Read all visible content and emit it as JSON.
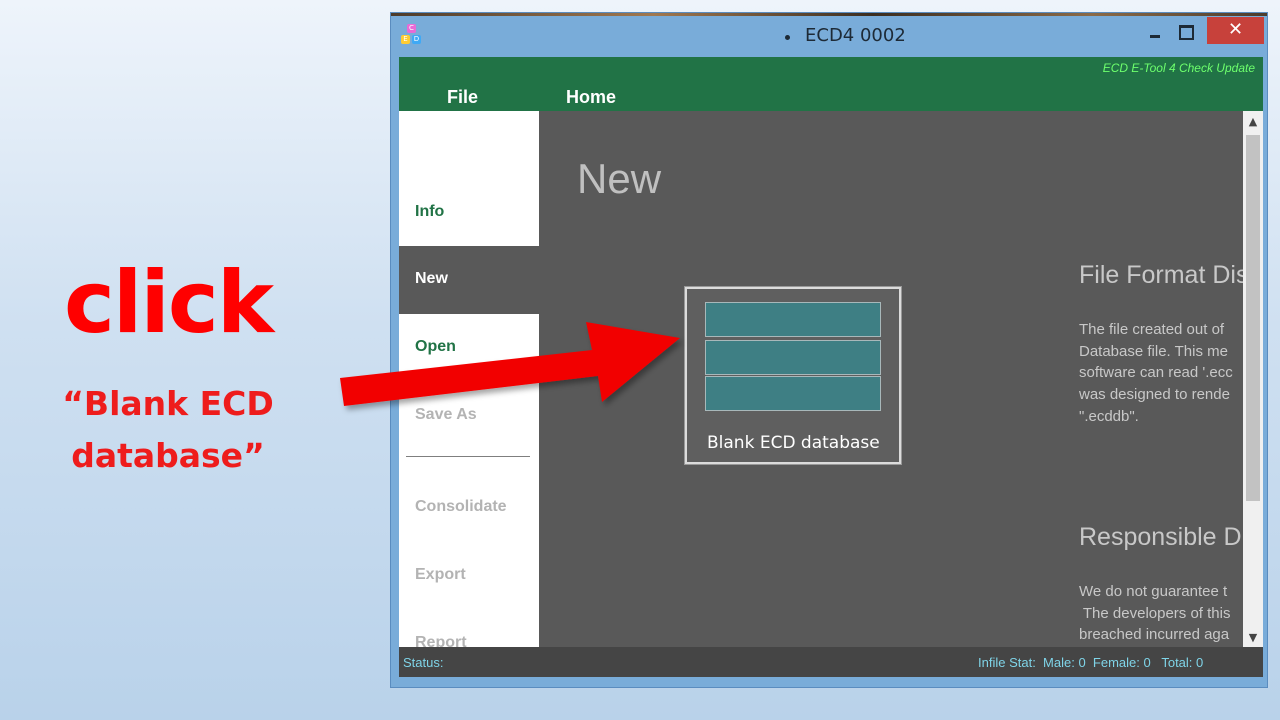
{
  "annotation": {
    "headline": "click",
    "caption_line1": "“Blank ECD",
    "caption_line2": "database”"
  },
  "window": {
    "title": "ECD4 0002",
    "close_glyph": "✕"
  },
  "ribbon": {
    "check_update": "ECD E-Tool 4 Check Update",
    "file_menu": "File",
    "home_menu": "Home"
  },
  "sidebar": {
    "items": [
      {
        "label": "Info",
        "state": "enabled"
      },
      {
        "label": "New",
        "state": "selected"
      },
      {
        "label": "Open",
        "state": "enabled"
      },
      {
        "label": "Save As",
        "state": "disabled"
      },
      {
        "label": "Consolidate",
        "state": "disabled"
      },
      {
        "label": "Export",
        "state": "disabled"
      },
      {
        "label": "Report",
        "state": "disabled"
      }
    ]
  },
  "main": {
    "page_title": "New",
    "template_label": "Blank ECD database",
    "file_format": {
      "heading": "File Format Dis",
      "lines": [
        "The file created out of",
        "Database file. This me",
        "software can read '.ecc",
        "was designed to rende",
        "\".ecddb\"."
      ]
    },
    "responsible": {
      "heading": "Responsible D",
      "lines": [
        "We do not guarantee t",
        " The developers of this",
        "breached incurred aga"
      ]
    }
  },
  "scrollbar": {
    "up_glyph": "▲",
    "down_glyph": "▼"
  },
  "status": {
    "label": "Status:",
    "infile_stat": "Infile Stat:",
    "male": "Male: 0",
    "female": "Female: 0",
    "total": "Total: 0"
  },
  "colors": {
    "ribbon_green": "#217346",
    "annotation_red": "#ff0000",
    "status_text": "#7fd4e8",
    "template_tile": "#3e7f84"
  }
}
